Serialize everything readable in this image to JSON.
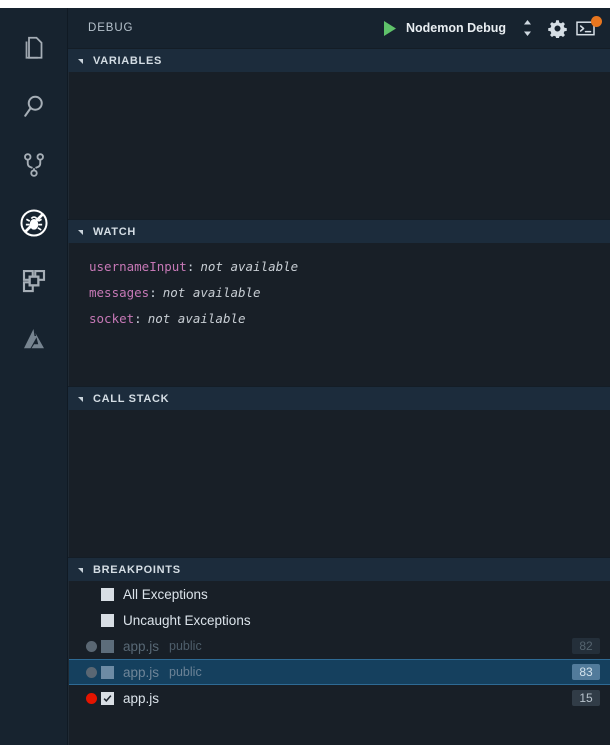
{
  "activity_bar": {
    "items": [
      {
        "name": "explorer",
        "icon": "files-icon",
        "active": false
      },
      {
        "name": "search",
        "icon": "search-icon",
        "active": false
      },
      {
        "name": "source-control",
        "icon": "source-control-icon",
        "active": false
      },
      {
        "name": "debug",
        "icon": "debug-icon",
        "active": true
      },
      {
        "name": "extensions",
        "icon": "extensions-icon",
        "active": false
      },
      {
        "name": "azure",
        "icon": "azure-icon",
        "active": false
      }
    ]
  },
  "panel": {
    "title": "DEBUG",
    "run_icon": "play-icon",
    "configuration": "Nodemon Debug",
    "config_dropdown_icon": "up-down-chevron-icon",
    "settings_icon": "gear-icon",
    "console_icon": "debug-console-icon",
    "console_badge": true
  },
  "sections": {
    "variables": {
      "label": "VARIABLES",
      "expanded": true,
      "items": []
    },
    "watch": {
      "label": "WATCH",
      "expanded": true,
      "items": [
        {
          "name": "usernameInput",
          "separator": ":",
          "value": "not available"
        },
        {
          "name": "messages",
          "separator": ":",
          "value": "not available"
        },
        {
          "name": "socket",
          "separator": ":",
          "value": "not available"
        }
      ]
    },
    "call_stack": {
      "label": "CALL STACK",
      "expanded": true,
      "items": []
    },
    "breakpoints": {
      "label": "BREAKPOINTS",
      "expanded": true,
      "items": [
        {
          "kind": "exception",
          "label": "All Exceptions",
          "checked": false,
          "enabled": true,
          "selected": false,
          "folder": "",
          "line": ""
        },
        {
          "kind": "exception",
          "label": "Uncaught Exceptions",
          "checked": false,
          "enabled": true,
          "selected": false,
          "folder": "",
          "line": ""
        },
        {
          "kind": "file",
          "label": "app.js",
          "folder": "public",
          "line": "82",
          "checked": false,
          "enabled": false,
          "selected": false
        },
        {
          "kind": "file",
          "label": "app.js",
          "folder": "public",
          "line": "83",
          "checked": false,
          "enabled": false,
          "selected": true
        },
        {
          "kind": "file",
          "label": "app.js",
          "folder": "",
          "line": "15",
          "checked": true,
          "enabled": true,
          "selected": false
        }
      ]
    }
  },
  "colors": {
    "activity_bar_bg": "#17232f",
    "panel_bg": "#181f27",
    "section_header_bg": "#1c2c3c",
    "selection_bg": "#15405e",
    "breakpoint_active": "#e51400",
    "breakpoint_disabled": "#5a6773",
    "watch_name": "#c678b6",
    "badge": "#e8761f",
    "run_green": "#5fc26a"
  }
}
